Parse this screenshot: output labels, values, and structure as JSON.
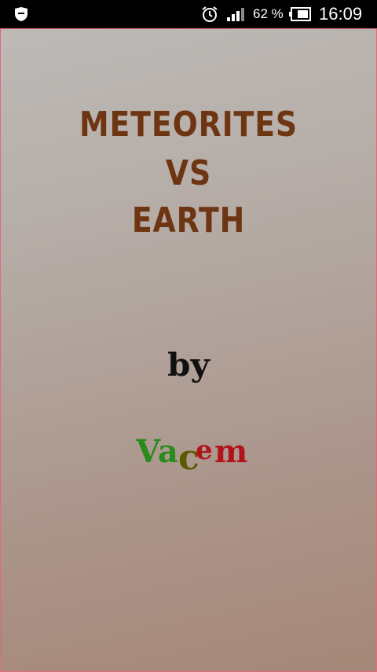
{
  "status_bar": {
    "battery_percent": "62 %",
    "time": "16:09",
    "icons": [
      "shield-icon",
      "alarm-clock-icon",
      "signal-icon",
      "battery-icon"
    ]
  },
  "splash": {
    "title_lines": [
      "METEORITES",
      "VS",
      "EARTH"
    ],
    "by": "by",
    "author_letters": [
      "V",
      "a",
      "c",
      "e",
      "m"
    ],
    "colors": {
      "title": "#6e3512",
      "author_green": "#2a8a1c",
      "author_olive": "#5b5a00",
      "author_red": "#b0141a",
      "border": "#e06b7a"
    }
  }
}
